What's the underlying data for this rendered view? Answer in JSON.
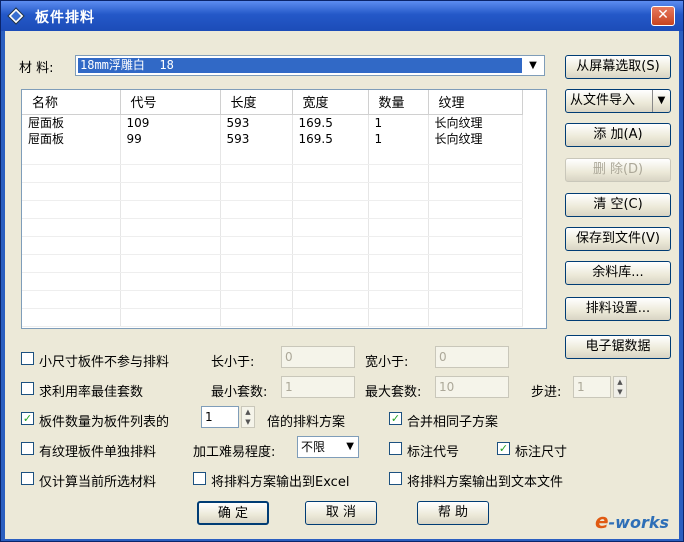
{
  "window": {
    "title": "板件排料",
    "close": "✕"
  },
  "material": {
    "label": "材 料:",
    "value": "18mm浮雕白  18"
  },
  "grid": {
    "headers": [
      "名称",
      "代号",
      "长度",
      "宽度",
      "数量",
      "纹理"
    ],
    "rows": [
      [
        "屉面板",
        "109",
        "593",
        "169.5",
        "1",
        "长向纹理"
      ],
      [
        "屉面板",
        "99",
        "593",
        "169.5",
        "1",
        "长向纹理"
      ]
    ]
  },
  "buttons": {
    "select_from_screen": "从屏幕选取(S)",
    "import_from_file": "从文件导入",
    "add": "添 加(A)",
    "delete": "删 除(D)",
    "clear": "清 空(C)",
    "save_to_file": "保存到文件(V)",
    "remnant_library": "余料库...",
    "layout_settings": "排料设置...",
    "saw_data": "电子锯数据",
    "ok": "确 定",
    "cancel": "取 消",
    "help": "帮 助"
  },
  "options": {
    "small_excluded": "小尺寸板件不参与排料",
    "len_less_label": "长小于:",
    "len_less_value": "0",
    "width_less_label": "宽小于:",
    "width_less_value": "0",
    "best_sets": "求利用率最佳套数",
    "min_sets_label": "最小套数:",
    "min_sets_value": "1",
    "max_sets_label": "最大套数:",
    "max_sets_value": "10",
    "step_label": "步进:",
    "step_value": "1",
    "qty_multiple": "板件数量为板件列表的",
    "qty_multiple_value": "1",
    "qty_multiple_suffix": "倍的排料方案",
    "merge_same": "合并相同子方案",
    "grain_separate": "有纹理板件单独排料",
    "difficulty_label": "加工难易程度:",
    "difficulty_value": "不限",
    "mark_code": "标注代号",
    "mark_size": "标注尺寸",
    "current_material_only": "仅计算当前所选材料",
    "export_excel": "将排料方案输出到Excel",
    "export_text": "将排料方案输出到文本文件"
  },
  "watermark": {
    "e": "e",
    "rest": "-works"
  }
}
